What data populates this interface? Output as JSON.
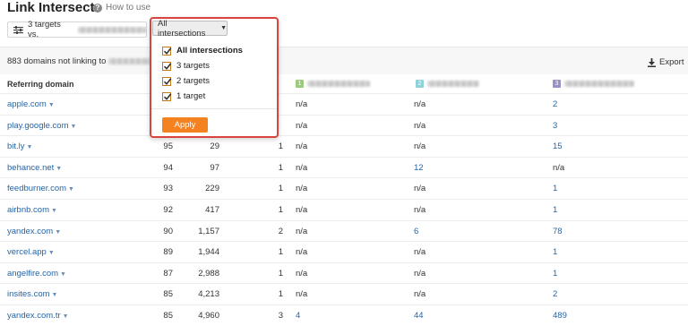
{
  "header": {
    "title": "Link Intersect",
    "how_to": "How to use"
  },
  "targets_button": {
    "label": "3 targets vs."
  },
  "intersections_dropdown": {
    "selected": "All intersections",
    "options": [
      {
        "label": "All intersections",
        "checked": true,
        "bold": true
      },
      {
        "label": "3 targets",
        "checked": true
      },
      {
        "label": "2 targets",
        "checked": true
      },
      {
        "label": "1 target",
        "checked": true
      }
    ],
    "apply_label": "Apply"
  },
  "summary": {
    "count_text": "883 domains not linking to",
    "export_label": "Export"
  },
  "table": {
    "header_domain": "Referring domain",
    "target_badges": [
      "1",
      "2",
      "3"
    ],
    "rows": [
      {
        "domain": "apple.com",
        "dr": "",
        "ref": "",
        "ints": "",
        "t1": "n/a",
        "t2": "n/a",
        "t3": "2"
      },
      {
        "domain": "play.google.com",
        "dr": "",
        "ref": "",
        "ints": "",
        "t1": "n/a",
        "t2": "n/a",
        "t3": "3"
      },
      {
        "domain": "bit.ly",
        "dr": "95",
        "ref": "29",
        "ints": "1",
        "t1": "n/a",
        "t2": "n/a",
        "t3": "15"
      },
      {
        "domain": "behance.net",
        "dr": "94",
        "ref": "97",
        "ints": "1",
        "t1": "n/a",
        "t2": "12",
        "t3": "n/a"
      },
      {
        "domain": "feedburner.com",
        "dr": "93",
        "ref": "229",
        "ints": "1",
        "t1": "n/a",
        "t2": "n/a",
        "t3": "1"
      },
      {
        "domain": "airbnb.com",
        "dr": "92",
        "ref": "417",
        "ints": "1",
        "t1": "n/a",
        "t2": "n/a",
        "t3": "1"
      },
      {
        "domain": "yandex.com",
        "dr": "90",
        "ref": "1,157",
        "ints": "2",
        "t1": "n/a",
        "t2": "6",
        "t3": "78"
      },
      {
        "domain": "vercel.app",
        "dr": "89",
        "ref": "1,944",
        "ints": "1",
        "t1": "n/a",
        "t2": "n/a",
        "t3": "1"
      },
      {
        "domain": "angelfire.com",
        "dr": "87",
        "ref": "2,988",
        "ints": "1",
        "t1": "n/a",
        "t2": "n/a",
        "t3": "1"
      },
      {
        "domain": "insites.com",
        "dr": "85",
        "ref": "4,213",
        "ints": "1",
        "t1": "n/a",
        "t2": "n/a",
        "t3": "2"
      },
      {
        "domain": "yandex.com.tr",
        "dr": "85",
        "ref": "4,960",
        "ints": "3",
        "t1": "4",
        "t2": "44",
        "t3": "489"
      }
    ]
  },
  "colors": {
    "accent": "#f58220",
    "highlight_border": "#d9443f",
    "link": "#2565a8",
    "badge1": "#9ccb7b",
    "badge2": "#8fd1d8",
    "badge3": "#9a8fc8"
  }
}
